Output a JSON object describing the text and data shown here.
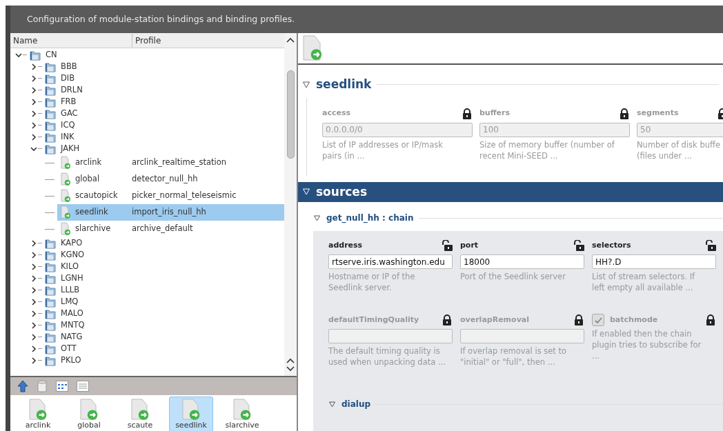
{
  "header": {
    "text": "Configuration of module-station bindings and binding profiles."
  },
  "tree": {
    "columns": [
      "Name",
      "Profile"
    ],
    "items": [
      {
        "label": "CN",
        "expanded": true,
        "children": [
          {
            "label": "BBB",
            "expanded": false
          },
          {
            "label": "DIB",
            "expanded": false
          },
          {
            "label": "DRLN",
            "expanded": false
          },
          {
            "label": "FRB",
            "expanded": false
          },
          {
            "label": "GAC",
            "expanded": false
          },
          {
            "label": "ICQ",
            "expanded": false
          },
          {
            "label": "INK",
            "expanded": false
          },
          {
            "label": "JAKH",
            "expanded": true,
            "children": [
              {
                "label": "arclink",
                "profile": "arclink_realtime_station",
                "selected": false
              },
              {
                "label": "global",
                "profile": "detector_null_hh",
                "selected": false
              },
              {
                "label": "scautopick",
                "profile": "picker_normal_teleseismic",
                "selected": false
              },
              {
                "label": "seedlink",
                "profile": "import_iris_null_hh",
                "selected": true
              },
              {
                "label": "slarchive",
                "profile": "archive_default",
                "selected": false
              }
            ]
          },
          {
            "label": "KAPO",
            "expanded": false
          },
          {
            "label": "KGNO",
            "expanded": false
          },
          {
            "label": "KILO",
            "expanded": false
          },
          {
            "label": "LGNH",
            "expanded": false
          },
          {
            "label": "LLLB",
            "expanded": false
          },
          {
            "label": "LMQ",
            "expanded": false
          },
          {
            "label": "MALO",
            "expanded": false
          },
          {
            "label": "MNTQ",
            "expanded": false
          },
          {
            "label": "NATG",
            "expanded": false
          },
          {
            "label": "OTT",
            "expanded": false
          },
          {
            "label": "PKLO",
            "expanded": false
          }
        ]
      }
    ]
  },
  "modules": [
    {
      "label": "arclink",
      "selected": false
    },
    {
      "label": "global",
      "selected": false
    },
    {
      "label": "scaute",
      "selected": false
    },
    {
      "label": "seedlink",
      "selected": true
    },
    {
      "label": "slarchive",
      "selected": false
    }
  ],
  "detail": {
    "sections": [
      {
        "title": "seedlink",
        "expanded": true,
        "highlighted": false,
        "params": [
          {
            "kind": "text",
            "name": "access",
            "value": "0.0.0.0/0",
            "locked": true,
            "description": [
              "List of IP addresses or IP/mask",
              "pairs (in ..."
            ]
          },
          {
            "kind": "text",
            "name": "buffers",
            "value": "100",
            "locked": true,
            "description": [
              "Size of memory buffer (number of",
              "recent Mini-SEED ..."
            ]
          },
          {
            "kind": "text",
            "name": "segments",
            "value": "50",
            "locked": true,
            "description": [
              "Number of disk buffe",
              "(files under ..."
            ]
          }
        ]
      },
      {
        "title": "sources",
        "expanded": true,
        "highlighted": true,
        "groups": [
          {
            "title": "get_null_hh : chain",
            "expanded": true,
            "params": [
              {
                "kind": "text",
                "name": "address",
                "value": "rtserve.iris.washington.edu",
                "locked": false,
                "description": [
                  "Hostname or IP of the",
                  "Seedlink server."
                ]
              },
              {
                "kind": "text",
                "name": "port",
                "value": "18000",
                "locked": false,
                "description": [
                  "Port of the Seedlink server"
                ]
              },
              {
                "kind": "text",
                "name": "selectors",
                "value": "HH?.D",
                "locked": false,
                "description": [
                  "List of stream selectors. If",
                  "left empty all available ..."
                ]
              },
              {
                "kind": "text",
                "name": "defaultTimingQuality",
                "locked": true,
                "description": [
                  "The default timing quality is",
                  "used when unpacking data ..."
                ]
              },
              {
                "kind": "text",
                "name": "overlapRemoval",
                "locked": true,
                "description": [
                  "If overlap removal is set to",
                  "\"initial\" or \"full\", then ..."
                ]
              },
              {
                "kind": "checkbox",
                "name": "batchmode",
                "checked": true,
                "locked": true,
                "description": [
                  "If enabled then the chain",
                  "plugin tries to subscribe for",
                  "..."
                ]
              }
            ],
            "subgroups": [
              {
                "title": "dialup",
                "expanded": true
              }
            ]
          }
        ]
      }
    ]
  }
}
